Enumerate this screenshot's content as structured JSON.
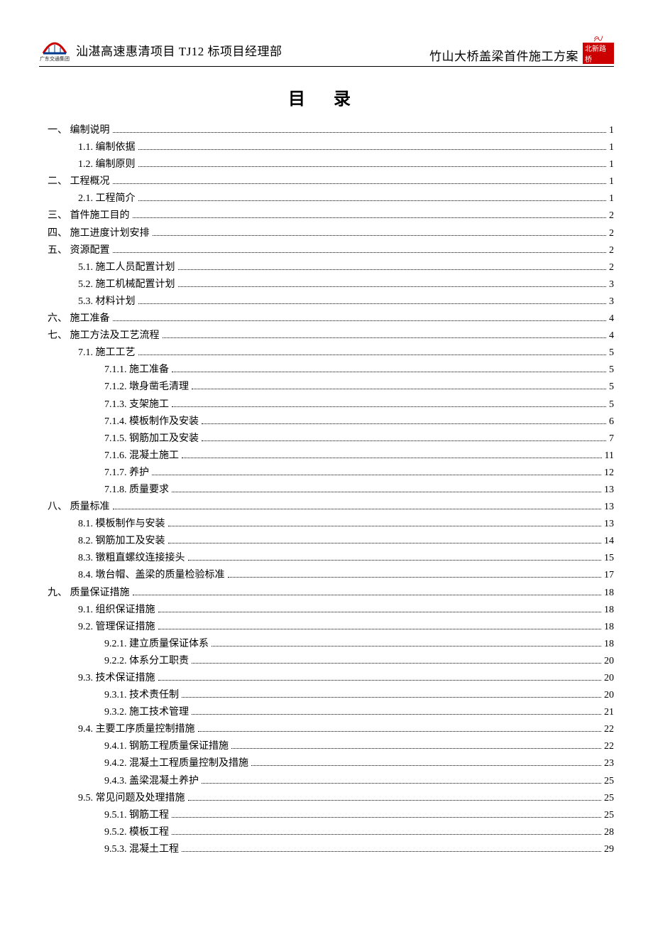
{
  "header": {
    "left_text": "汕湛高速惠清项目 TJ12 标项目经理部",
    "right_text": "竹山大桥盖梁首件施工方案",
    "left_logo_sub": "广东交通集团",
    "right_logo_sub": "北新路桥"
  },
  "toc_title": "目录",
  "toc": [
    {
      "indent": 0,
      "label": "一、 编制说明",
      "page": "1"
    },
    {
      "indent": 1,
      "label": "1.1. 编制依据",
      "page": "1"
    },
    {
      "indent": 1,
      "label": "1.2. 编制原则",
      "page": "1"
    },
    {
      "indent": 0,
      "label": "二、 工程概况",
      "page": "1"
    },
    {
      "indent": 1,
      "label": "2.1. 工程简介",
      "page": "1"
    },
    {
      "indent": 0,
      "label": "三、 首件施工目的",
      "page": "2"
    },
    {
      "indent": 0,
      "label": "四、 施工进度计划安排",
      "page": "2"
    },
    {
      "indent": 0,
      "label": "五、 资源配置",
      "page": "2"
    },
    {
      "indent": 1,
      "label": "5.1. 施工人员配置计划",
      "page": "2"
    },
    {
      "indent": 1,
      "label": "5.2. 施工机械配置计划",
      "page": "3"
    },
    {
      "indent": 1,
      "label": "5.3. 材料计划",
      "page": "3"
    },
    {
      "indent": 0,
      "label": "六、 施工准备",
      "page": "4"
    },
    {
      "indent": 0,
      "label": "七、 施工方法及工艺流程",
      "page": "4"
    },
    {
      "indent": 1,
      "label": "7.1. 施工工艺",
      "page": "5"
    },
    {
      "indent": 2,
      "label": "7.1.1. 施工准备",
      "page": "5"
    },
    {
      "indent": 2,
      "label": "7.1.2. 墩身凿毛清理",
      "page": "5"
    },
    {
      "indent": 2,
      "label": "7.1.3. 支架施工",
      "page": "5"
    },
    {
      "indent": 2,
      "label": "7.1.4. 模板制作及安装",
      "page": "6"
    },
    {
      "indent": 2,
      "label": "7.1.5. 钢筋加工及安装",
      "page": "7"
    },
    {
      "indent": 2,
      "label": "7.1.6. 混凝土施工",
      "page": "11"
    },
    {
      "indent": 2,
      "label": "7.1.7. 养护",
      "page": "12"
    },
    {
      "indent": 2,
      "label": "7.1.8. 质量要求",
      "page": "13"
    },
    {
      "indent": 0,
      "label": "八、 质量标准",
      "page": "13"
    },
    {
      "indent": 1,
      "label": "8.1. 模板制作与安装",
      "page": "13"
    },
    {
      "indent": 1,
      "label": "8.2. 钢筋加工及安装",
      "page": "14"
    },
    {
      "indent": 1,
      "label": "8.3. 镦粗直螺纹连接接头",
      "page": "15"
    },
    {
      "indent": 1,
      "label": "8.4. 墩台帽、盖梁的质量检验标准",
      "page": "17"
    },
    {
      "indent": 0,
      "label": "九、 质量保证措施",
      "page": "18"
    },
    {
      "indent": 1,
      "label": "9.1. 组织保证措施",
      "page": "18"
    },
    {
      "indent": 1,
      "label": "9.2. 管理保证措施",
      "page": "18"
    },
    {
      "indent": 2,
      "label": "9.2.1. 建立质量保证体系",
      "page": "18"
    },
    {
      "indent": 2,
      "label": "9.2.2. 体系分工职责",
      "page": "20"
    },
    {
      "indent": 1,
      "label": "9.3. 技术保证措施",
      "page": "20"
    },
    {
      "indent": 2,
      "label": "9.3.1. 技术责任制",
      "page": "20"
    },
    {
      "indent": 2,
      "label": "9.3.2. 施工技术管理",
      "page": "21"
    },
    {
      "indent": 1,
      "label": "9.4. 主要工序质量控制措施",
      "page": "22"
    },
    {
      "indent": 2,
      "label": "9.4.1. 钢筋工程质量保证措施",
      "page": "22"
    },
    {
      "indent": 2,
      "label": "9.4.2. 混凝土工程质量控制及措施",
      "page": "23"
    },
    {
      "indent": 2,
      "label": "9.4.3. 盖梁混凝土养护",
      "page": "25"
    },
    {
      "indent": 1,
      "label": "9.5. 常见问题及处理措施",
      "page": "25"
    },
    {
      "indent": 2,
      "label": "9.5.1. 钢筋工程",
      "page": "25"
    },
    {
      "indent": 2,
      "label": "9.5.2. 模板工程",
      "page": "28"
    },
    {
      "indent": 2,
      "label": "9.5.3. 混凝土工程",
      "page": "29"
    }
  ]
}
